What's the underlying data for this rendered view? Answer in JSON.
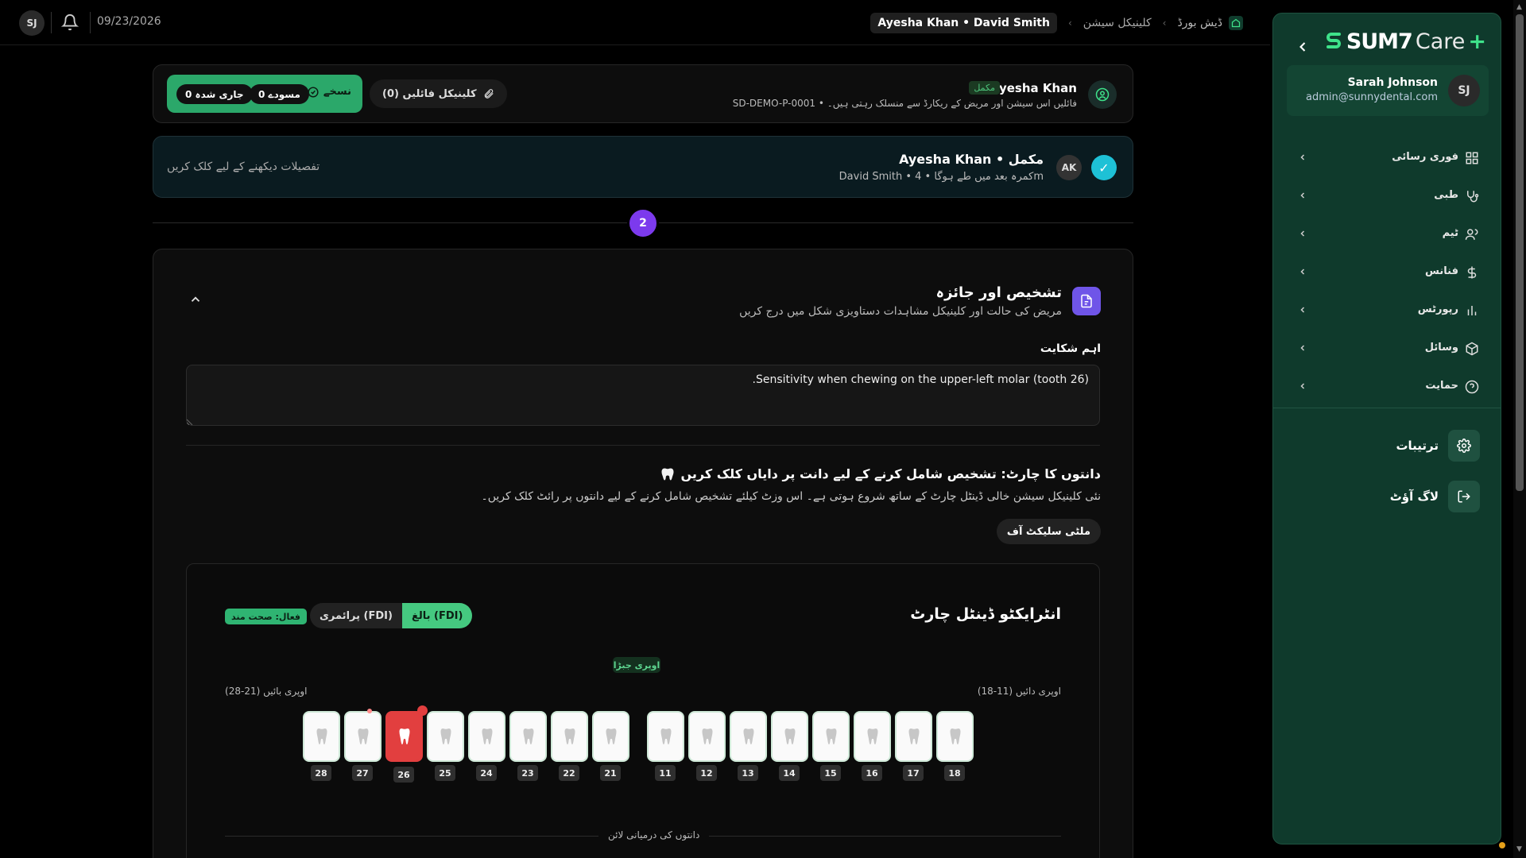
{
  "topbar": {
    "avatar_initials": "SJ",
    "date": "09/23/2026",
    "breadcrumb": {
      "home": "ڈیش بورڈ",
      "section": "کلینیکل سیشن",
      "current": "Ayesha Khan • David Smith"
    }
  },
  "sidebar": {
    "logo": {
      "brand": "SUM7",
      "suffix": "Care",
      "plus": "+"
    },
    "user": {
      "initials": "SJ",
      "name": "Sarah Johnson",
      "email": "admin@sunnydental.com"
    },
    "nav": [
      {
        "label": "فوری رسائی",
        "icon": "grid-icon"
      },
      {
        "label": "طبی",
        "icon": "stethoscope-icon"
      },
      {
        "label": "ٹیم",
        "icon": "users-icon"
      },
      {
        "label": "فنانس",
        "icon": "dollar-icon"
      },
      {
        "label": "رپورٹس",
        "icon": "bar-chart-icon"
      },
      {
        "label": "وسائل",
        "icon": "box-icon"
      },
      {
        "label": "حمایت",
        "icon": "help-circle-icon"
      }
    ],
    "settings_label": "ترتیبات",
    "logout_label": "لاگ آؤٹ"
  },
  "patient": {
    "name": "Ayesha Khan",
    "status": "مکمل",
    "subtitle": "SD-DEMO-P-0001 • فائلیں اس سیشن اور مریض کے ریکارڈ سے منسلک رہتی ہیں۔",
    "clinical_files": "کلینیکل فائلیں (0)",
    "notes_label": "نسخے",
    "drafts_pill": "0 مسودے",
    "ongoing_pill": "0 جاری شدہ"
  },
  "session": {
    "check": "✓",
    "initials": "AK",
    "title": "Ayesha Khan • مکمل",
    "subtitle": "David Smith • کمرہ بعد میں طے ہوگا • 4m",
    "details_link": "تفصیلات دیکھنے کے لیے کلک کریں"
  },
  "step_number": "2",
  "diagnosis": {
    "title": "تشخیص اور جائزہ",
    "subtitle": "مریض کی حالت اور کلینیکل مشاہدات دستاویزی شکل میں درج کریں",
    "complaint_label": "اہم شکایت",
    "complaint_value": "Sensitivity when chewing on the upper-left molar (tooth 26).",
    "tooth_chart_title": "دانتوں کا چارٹ: تشخیص شامل کرنے کے لیے دانت پر دایاں کلک کریں",
    "tooth_chart_desc": "نئی کلینیکل سیشن خالی ڈینٹل چارٹ کے ساتھ شروع ہوتی ہے۔ اس وزٹ کیلئے تشخیص شامل کرنے کے لیے دانتوں پر رائٹ کلک کریں۔",
    "multiselect_label": "ملٹی سلیکٹ آف"
  },
  "dental_chart": {
    "title": "انٹرایکٹو ڈینٹل چارٹ",
    "toggle_adult": "بالغ (FDI)",
    "toggle_primary": "پرائمری (FDI)",
    "active_badge": "فعال: صحت مند",
    "upper_jaw": "اوپری جبڑا",
    "upper_left_label": "اوپری بائیں (21-28)",
    "upper_right_label": "اوپری دائیں (11-18)",
    "midline_label": "دانتوں کی درمیانی لائن",
    "upper_left_teeth": [
      "28",
      "27",
      "26",
      "25",
      "24",
      "23",
      "22",
      "21"
    ],
    "upper_right_teeth": [
      "11",
      "12",
      "13",
      "14",
      "15",
      "16",
      "17",
      "18"
    ],
    "selected_tooth": "26",
    "colors": {
      "selected": "#e23f3f",
      "healthy": "#45c980"
    }
  }
}
